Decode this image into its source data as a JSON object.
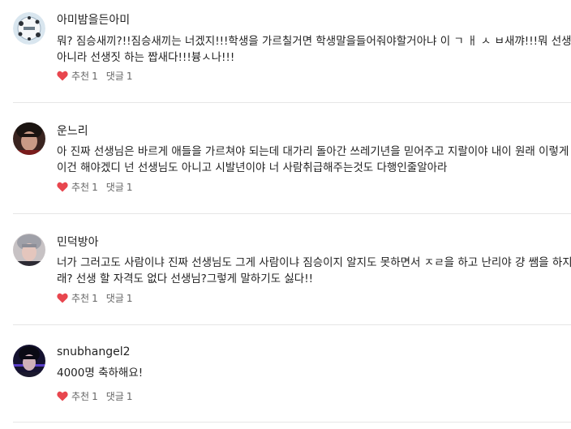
{
  "comments": [
    {
      "username": "아미밤을든아미",
      "lines": [
        "뭐? 짐승새끼?!!짐승새끼는 너겠지!!!학생을 가르칠거면 학생말을들어줘야할거아냐 이 ㄱ ㅐ ㅅ ㅂ새꺄!!!뭐 선생님",
        "아니라 선생짓 하는 짭새다!!!븅ㅅ나!!!"
      ],
      "like_label": "추천",
      "like_count": "1",
      "reply_label": "댓글",
      "reply_count": "1"
    },
    {
      "username": "운느리",
      "lines": [
        "아 진짜 선생님은 바르게 애들을 가르쳐야 되는데 대가리 돌아간 쓰레기년을 믿어주고 지랄이야 내이 원래 이렇게",
        "이건 해야겠디 넌 선생님도 아니고 시발년이야 너 사람취급해주는것도 다행인줄알아라"
      ],
      "like_label": "추천",
      "like_count": "1",
      "reply_label": "댓글",
      "reply_count": "1"
    },
    {
      "username": "민덕방아",
      "lines": [
        "너가 그러고도 사람이냐 진짜 선생님도 그게 사람이냐 짐승이지 알지도 못하면서 ㅈㄹ을 하고 난리야 걍 쌤을 하지",
        "래? 선생 할 자격도 없다 선생님?그렇게 말하기도 싫다!!"
      ],
      "like_label": "추천",
      "like_count": "1",
      "reply_label": "댓글",
      "reply_count": "1"
    },
    {
      "username": "snubhangel2",
      "lines": [
        "4000명 축하해요!"
      ],
      "like_label": "추천",
      "like_count": "1",
      "reply_label": "댓글",
      "reply_count": "1"
    }
  ],
  "colors": {
    "heart": "#e8464e",
    "divider": "#e6e6e6"
  },
  "icons": {
    "like": "heart-icon"
  }
}
